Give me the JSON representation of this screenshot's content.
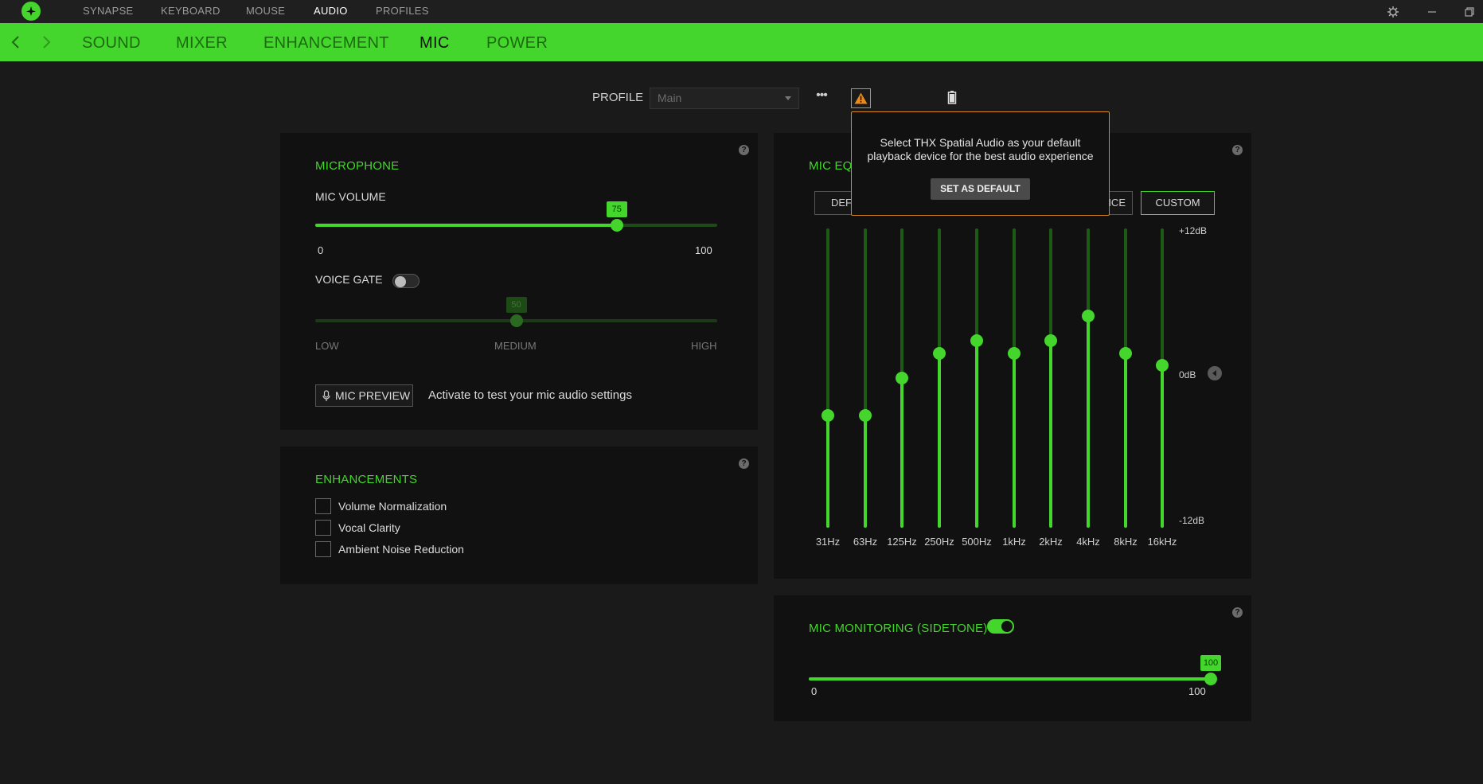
{
  "topbar": {
    "tabs": [
      "SYNAPSE",
      "KEYBOARD",
      "MOUSE",
      "AUDIO",
      "PROFILES"
    ],
    "active_tab": "AUDIO"
  },
  "subnav": {
    "tabs": [
      "SOUND",
      "MIXER",
      "ENHANCEMENT",
      "MIC",
      "POWER"
    ],
    "active_tab": "MIC"
  },
  "profile": {
    "label": "PROFILE",
    "selected": "Main",
    "more": "•••"
  },
  "popup": {
    "message": "Select THX Spatial Audio as your default playback device for the best audio experience",
    "button": "SET AS DEFAULT"
  },
  "microphone": {
    "title": "MICROPHONE",
    "volume_label": "MIC VOLUME",
    "volume_value": "75",
    "volume_level": 75,
    "min": "0",
    "max": "100",
    "voice_gate_label": "VOICE GATE",
    "voice_gate_enabled": false,
    "gate_value": "50",
    "gate_level": 50,
    "gate_low": "LOW",
    "gate_medium": "MEDIUM",
    "gate_high": "HIGH",
    "preview_button": "MIC PREVIEW",
    "preview_hint": "Activate to test your mic audio settings"
  },
  "enhancements": {
    "title": "ENHANCEMENTS",
    "items": [
      "Volume Normalization",
      "Vocal Clarity",
      "Ambient Noise Reduction"
    ],
    "checked": [
      false,
      false,
      false
    ]
  },
  "equalizer": {
    "title": "MIC EQU",
    "preset_left": "DEFA",
    "preset_right": "NCE",
    "preset_custom": "CUSTOM",
    "db_top": "+12dB",
    "db_mid": "0dB",
    "db_bottom": "-12dB",
    "bands": [
      "31Hz",
      "63Hz",
      "125Hz",
      "250Hz",
      "500Hz",
      "1kHz",
      "2kHz",
      "4kHz",
      "8kHz",
      "16kHz"
    ],
    "gains_db": [
      -3,
      -3,
      0,
      2,
      3,
      2,
      3,
      5,
      2,
      1
    ]
  },
  "monitoring": {
    "title": "MIC MONITORING (SIDETONE)",
    "enabled": true,
    "value": "100",
    "level": 100,
    "min": "0",
    "max": "100"
  },
  "colors": {
    "accent": "#44d62c",
    "warning": "#d98a1f",
    "background": "#1a1a1a",
    "panel": "#111111"
  }
}
